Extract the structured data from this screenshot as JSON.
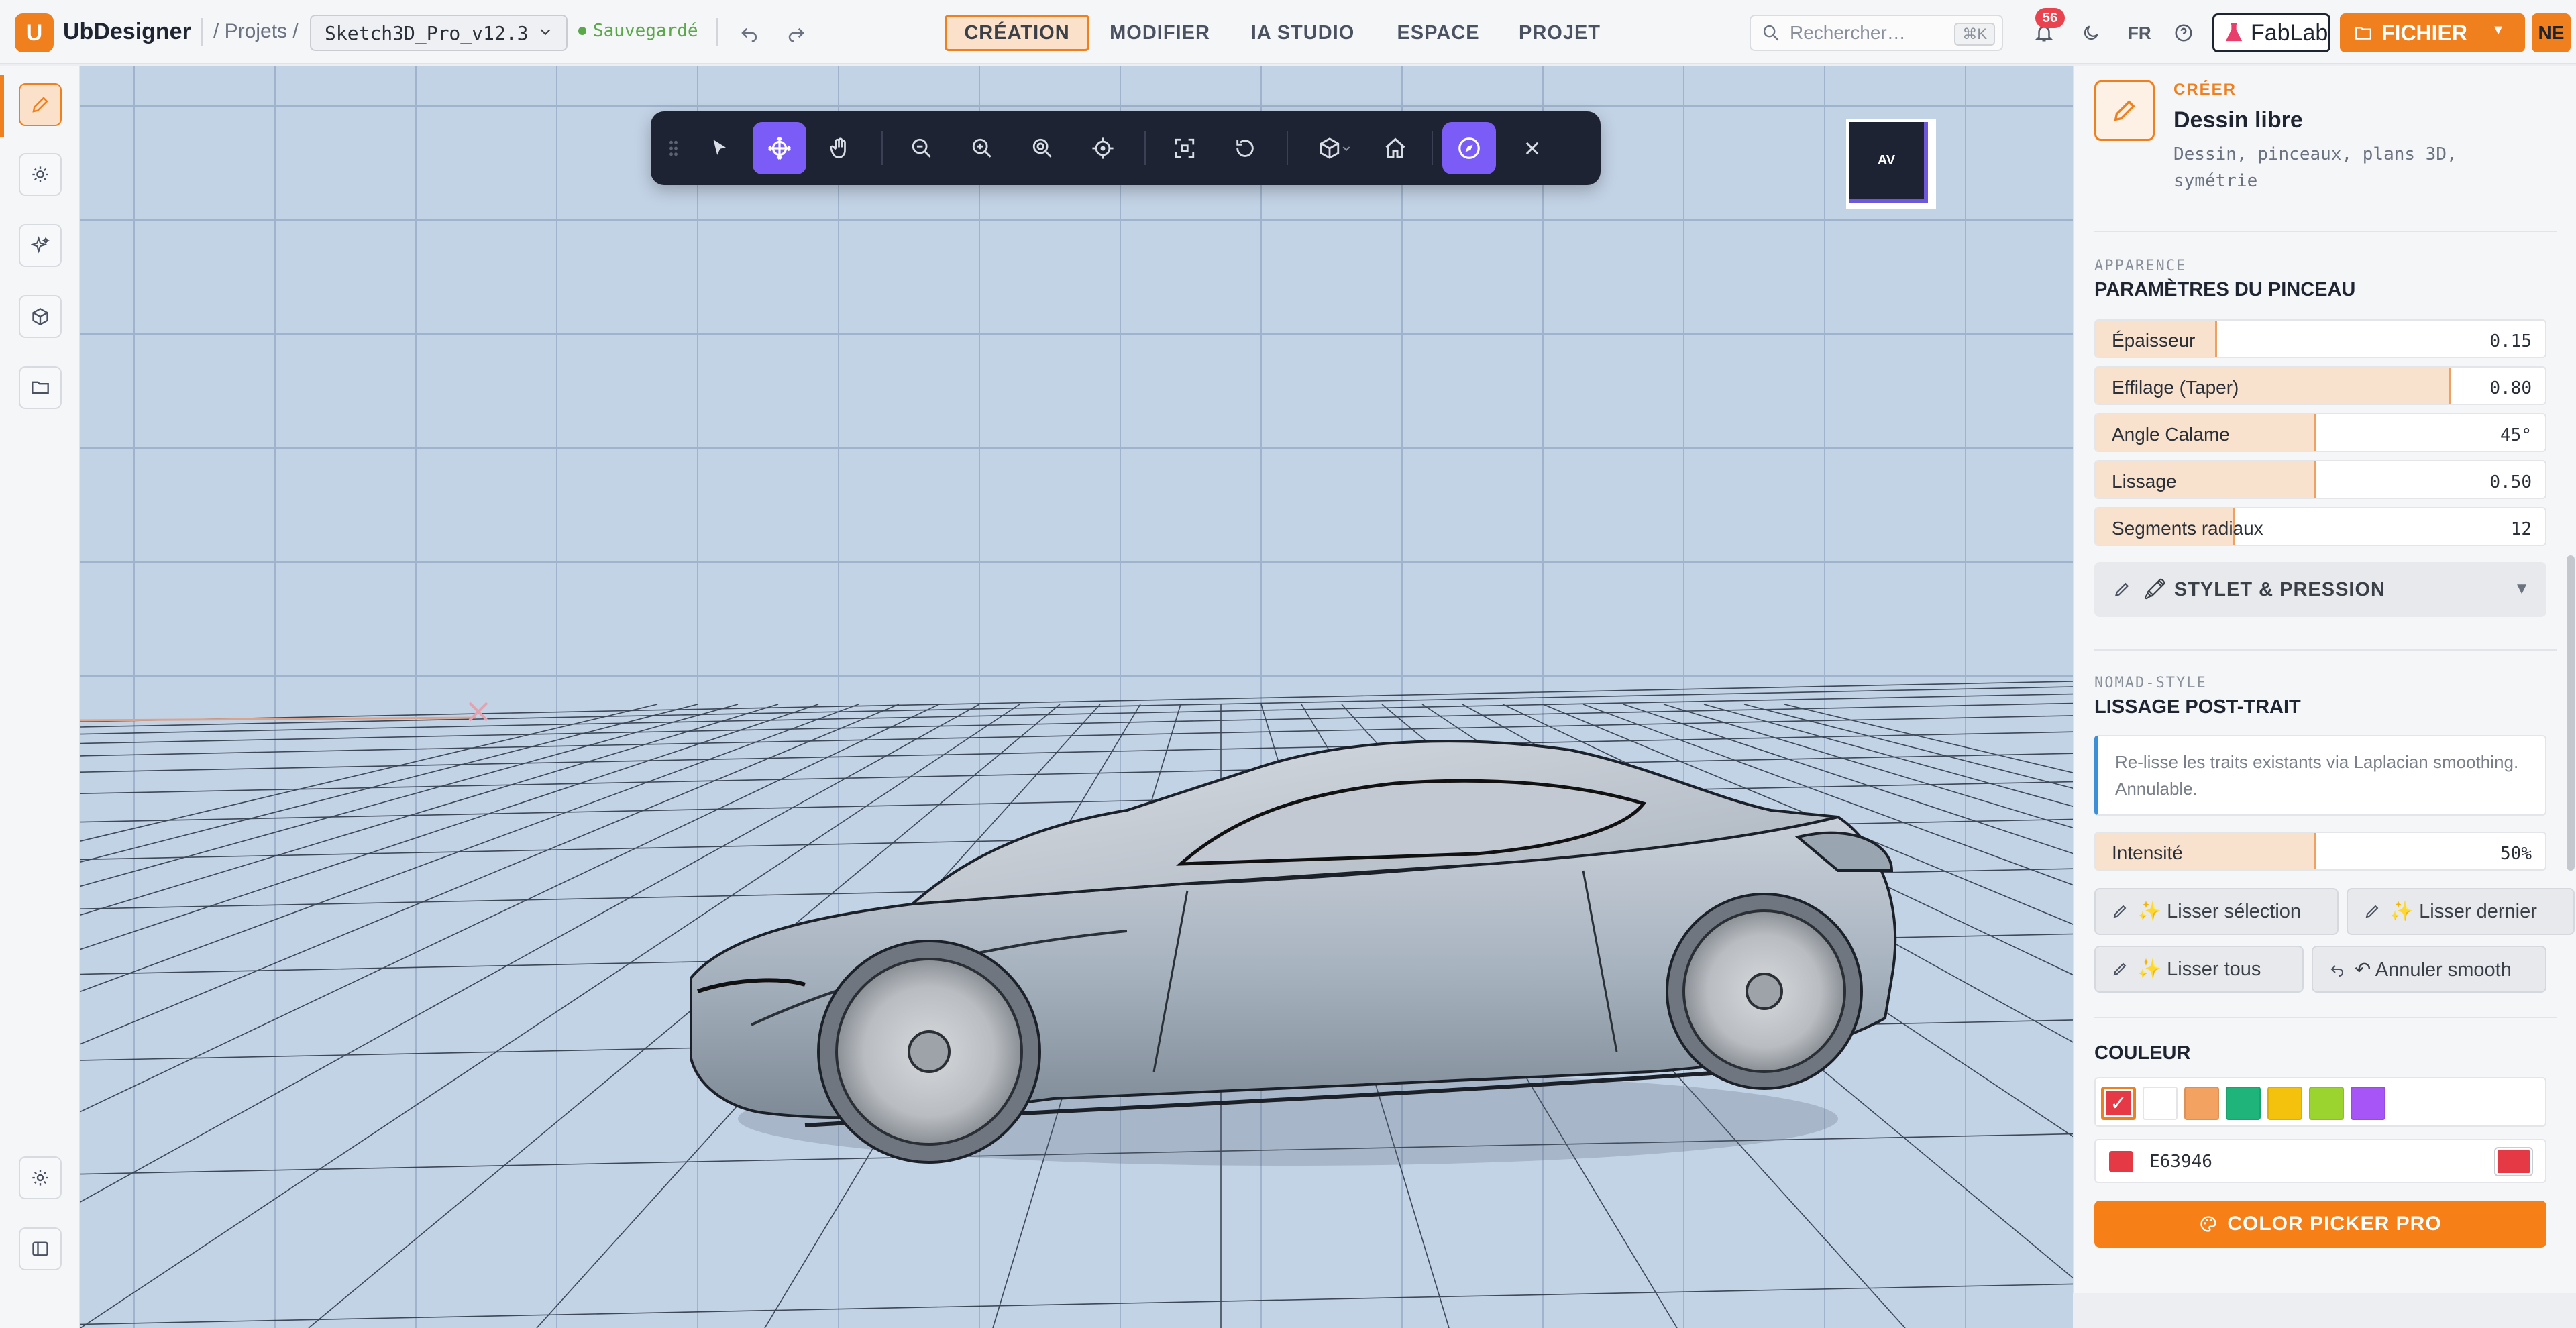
{
  "app": {
    "logo_letter": "U",
    "name": "UbDesigner"
  },
  "breadcrumb": {
    "projects": "/ Projets /",
    "project_name": "Sketch3D_Pro_v12.3",
    "saved": "Sauvegardé"
  },
  "nav_tabs": [
    "CRÉATION",
    "MODIFIER",
    "IA STUDIO",
    "ESPACE",
    "PROJET"
  ],
  "active_tab": "CRÉATION",
  "search": {
    "placeholder": "Rechercher…",
    "shortcut": "⌘K"
  },
  "notifications": {
    "count": "56"
  },
  "lang": "FR",
  "fablab_label": "FabLab",
  "fichier_label": "FICHIER",
  "user_initials": "NE",
  "left_rail": [
    "pencil-icon",
    "sun-icon",
    "sparkle-icon",
    "cube-icon",
    "folder-icon",
    "settings-icon",
    "sidebar-toggle-icon"
  ],
  "toolbar": {
    "tools": [
      "drag-handle",
      "select",
      "move-gizmo",
      "pan",
      "zoom-out",
      "zoom-in",
      "zoom-fit",
      "focus-target",
      "frame",
      "reset-view",
      "view-cube",
      "home",
      "navigation-compass",
      "close"
    ],
    "active": [
      "move-gizmo",
      "navigation-compass"
    ]
  },
  "view_cube": {
    "label": "AV"
  },
  "panel": {
    "eyebrow": "CRÉER",
    "title": "Dessin libre",
    "description": "Dessin, pinceaux, plans 3D, symétrie",
    "appearance_eyebrow": "APPARENCE",
    "appearance_title": "PARAMÈTRES DU PINCEAU",
    "sliders": [
      {
        "label": "Épaisseur",
        "value": "0.15",
        "fill": 0.27
      },
      {
        "label": "Effilage (Taper)",
        "value": "0.80",
        "fill": 0.79
      },
      {
        "label": "Angle Calame",
        "value": "45°",
        "fill": 0.49
      },
      {
        "label": "Lissage",
        "value": "0.50",
        "fill": 0.49
      },
      {
        "label": "Segments radiaux",
        "value": "12",
        "fill": 0.31
      }
    ],
    "stylus_section": "🖍 STYLET & PRESSION",
    "smooth_eyebrow": "NOMAD-STYLE",
    "smooth_title": "LISSAGE POST-TRAIT",
    "smooth_note": "Re-lisse les traits existants via Laplacian smoothing. Annulable.",
    "intensity": {
      "label": "Intensité",
      "value": "50%",
      "fill": 0.49
    },
    "smooth_buttons": {
      "selection": "✨ Lisser sélection",
      "last": "✨ Lisser dernier",
      "all": "✨ Lisser tous",
      "undo": "↶ Annuler smooth"
    },
    "color_title": "COULEUR",
    "swatches": [
      "#e63946",
      "#ffffff",
      "#f4a261",
      "#1fb57a",
      "#f4c20d",
      "#9bd42e",
      "#a855f7"
    ],
    "selected_swatch": "#e63946",
    "hex_value": "E63946",
    "color_picker_label": "COLOR PICKER PRO"
  },
  "colors": {
    "accent": "#f07f1e",
    "toolbar_bg": "#1e2333",
    "active_tool": "#7c5cf6",
    "viewport_bg": "#c3d3e6"
  }
}
